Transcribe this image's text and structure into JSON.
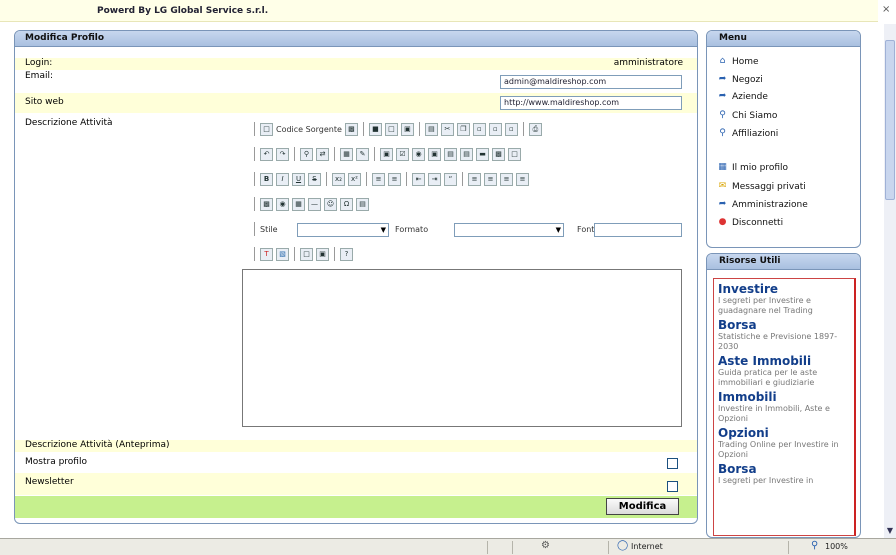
{
  "topbar": {
    "powered_by": "Powerd By LG Global Service s.r.l.",
    "corner_icon": "close-glyph"
  },
  "main": {
    "title": "Modifica Profilo",
    "fields": {
      "login_label": "Login:",
      "login_value": "amministratore",
      "email_label": "Email:",
      "email_value": "admin@maldireshop.com",
      "site_label": "Sito web",
      "site_value": "http://www.maldireshop.com",
      "desc_label": "Descrizione Attività",
      "desc_preview_label": "Descrizione Attività (Anteprima)",
      "show_profile_label": "Mostra profilo",
      "newsletter_label": "Newsletter"
    },
    "editor": {
      "source_label": "Codice Sorgente",
      "style_label": "Stile",
      "format_label": "Formato",
      "font_label": "Font"
    },
    "submit_label": "Modifica"
  },
  "menu": {
    "title": "Menu",
    "items": [
      {
        "label": "Home",
        "icon": "home-icon"
      },
      {
        "label": "Negozi",
        "icon": "arrow-right-icon"
      },
      {
        "label": "Aziende",
        "icon": "arrow-right-icon"
      },
      {
        "label": "Chi Siamo",
        "icon": "search-icon"
      },
      {
        "label": "Affiliazioni",
        "icon": "search-icon"
      },
      {
        "label": "Il mio profilo",
        "icon": "profile-icon"
      },
      {
        "label": "Messaggi privati",
        "icon": "envelope-icon"
      },
      {
        "label": "Amministrazione",
        "icon": "arrow-right-icon"
      },
      {
        "label": "Disconnetti",
        "icon": "logout-icon"
      }
    ]
  },
  "resources": {
    "title": "Risorse Utili",
    "items": [
      {
        "title": "Investire",
        "desc": "I segreti per Investire e guadagnare nel Trading"
      },
      {
        "title": "Borsa",
        "desc": "Statistiche e Previsione 1897-2030"
      },
      {
        "title": "Aste Immobili",
        "desc": "Guida pratica per le aste immobiliari e giudiziarie"
      },
      {
        "title": "Immobili",
        "desc": "Investire in Immobili, Aste e Opzioni"
      },
      {
        "title": "Opzioni",
        "desc": "Trading Online per Investire in Opzioni"
      },
      {
        "title": "Borsa",
        "desc": "I segreti per Investire in"
      }
    ]
  },
  "statusbar": {
    "zone_label": "Internet",
    "zoom_label": "100%"
  },
  "colors": {
    "panel_header": "#a9c0e0",
    "row_yellow": "#ffffd9",
    "row_green": "#c6f08e",
    "link_blue": "#123e8a"
  }
}
